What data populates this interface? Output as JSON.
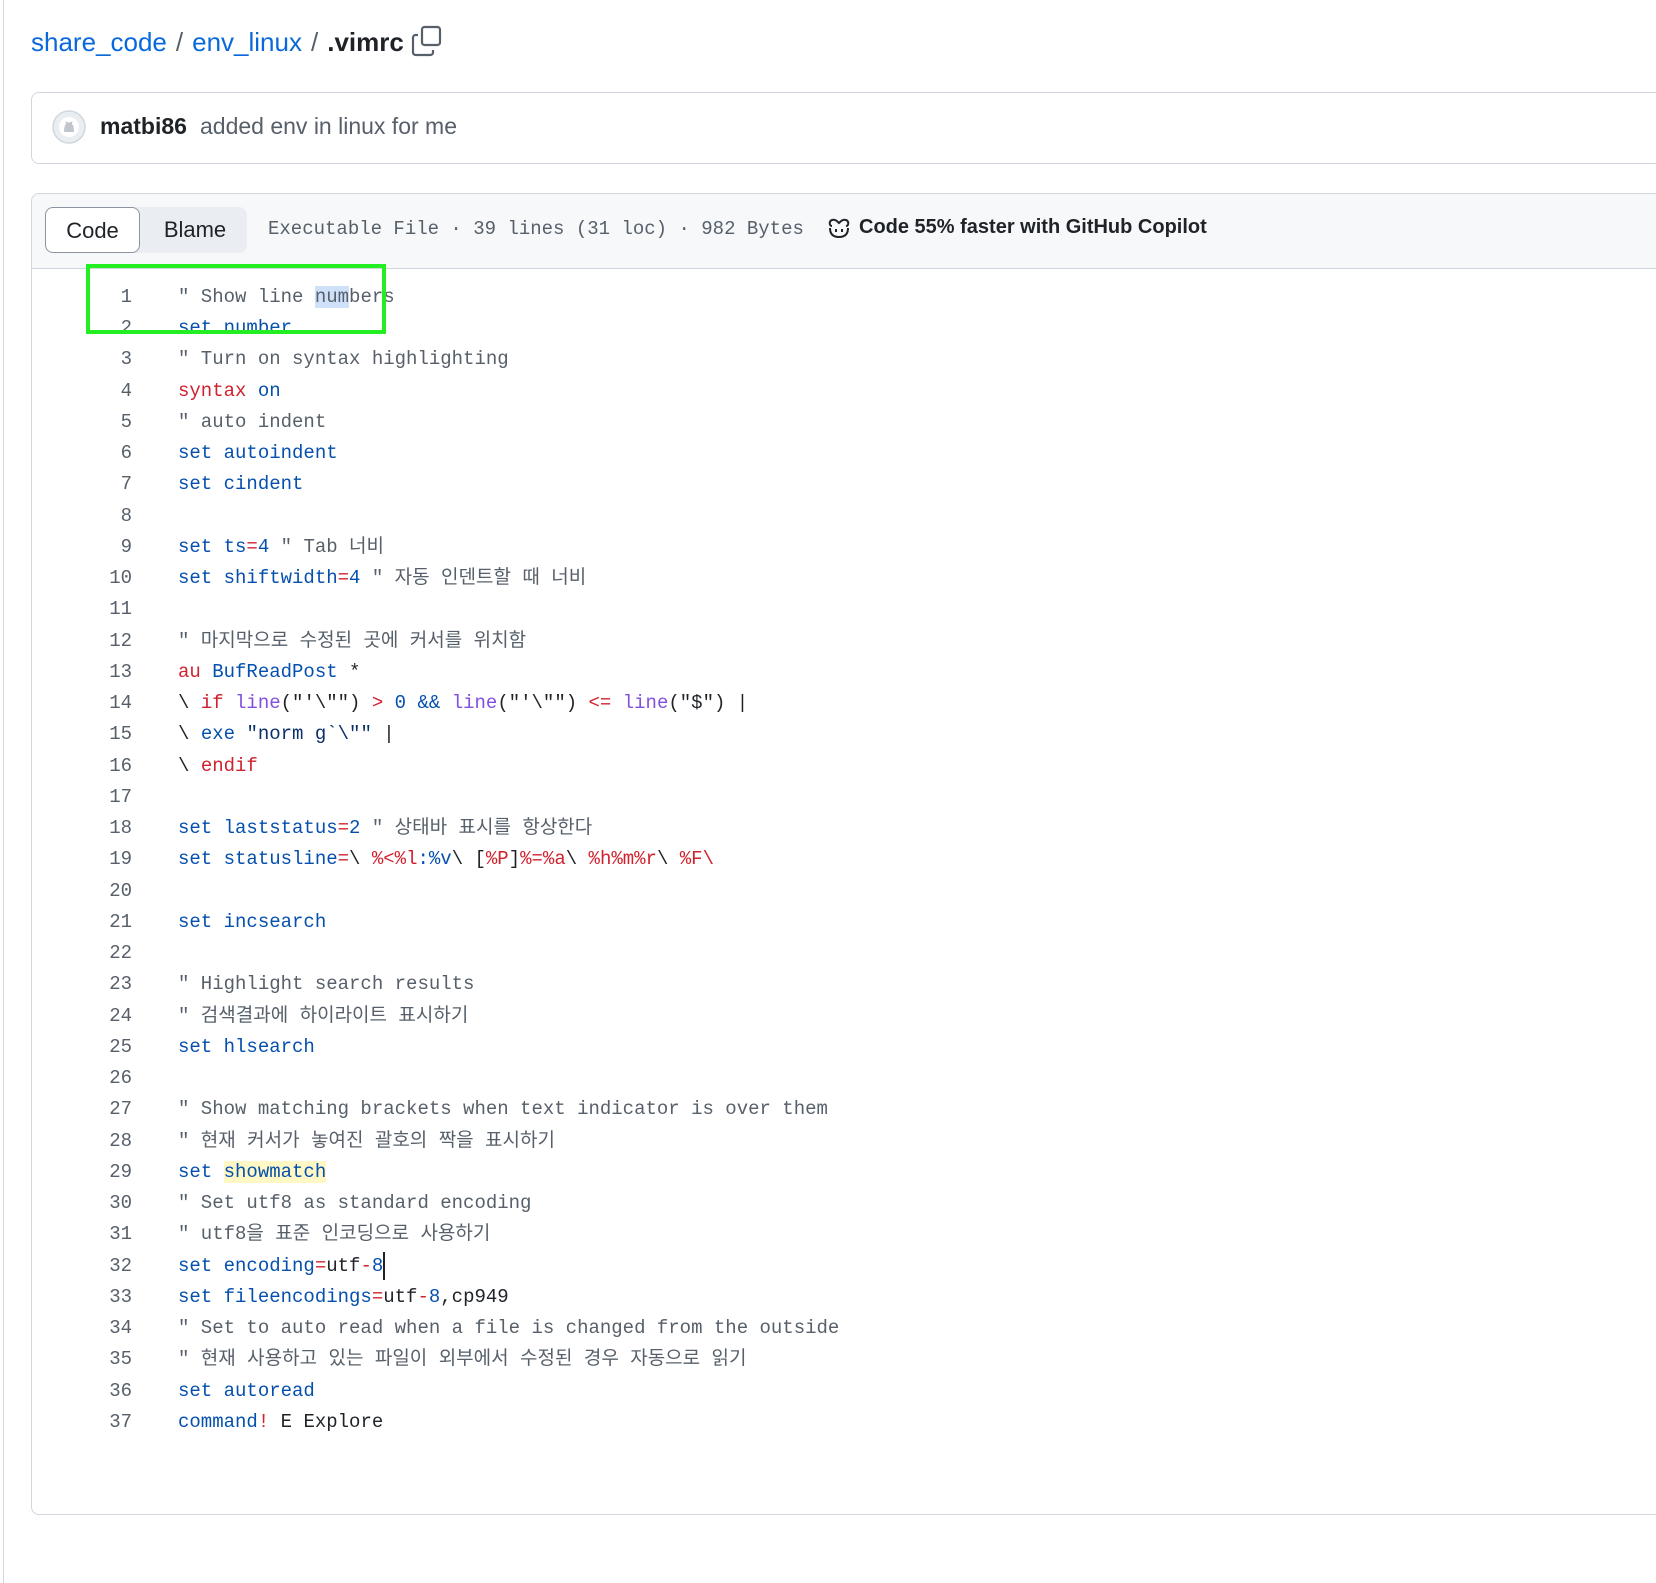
{
  "breadcrumb": {
    "repo": "share_code",
    "folder": "env_linux",
    "file": ".vimrc",
    "separator": "/"
  },
  "commit": {
    "author": "matbi86",
    "message": "added env in linux for me"
  },
  "file_header": {
    "tab_code": "Code",
    "tab_blame": "Blame",
    "meta": "Executable File · 39 lines (31 loc) · 982 Bytes",
    "copilot": "Code 55% faster with GitHub Copilot"
  },
  "code": {
    "line_numbers": [
      "1",
      "2",
      "3",
      "4",
      "5",
      "6",
      "7",
      "8",
      "9",
      "10",
      "11",
      "12",
      "13",
      "14",
      "15",
      "16",
      "17",
      "18",
      "19",
      "20",
      "21",
      "22",
      "23",
      "24",
      "25",
      "26",
      "27",
      "28",
      "29",
      "30",
      "31",
      "32",
      "33",
      "34",
      "35",
      "36",
      "37"
    ],
    "lines": [
      "\" Show line numbers",
      "set number",
      "\" Turn on syntax highlighting",
      "syntax on",
      "\" auto indent",
      "set autoindent",
      "set cindent",
      "",
      "set ts=4 \" Tab 너비",
      "set shiftwidth=4 \" 자동 인덴트할 때 너비",
      "",
      "\" 마지막으로 수정된 곳에 커서를 위치함",
      "au BufReadPost *",
      "\\ if line(\"'\\\"\") > 0 && line(\"'\\\"\") <= line(\"$\") |",
      "\\ exe \"norm g`\\\"\" |",
      "\\ endif",
      "",
      "set laststatus=2 \" 상태바 표시를 항상한다",
      "set statusline=\\ %<%l:%v\\ [%P]%=%a\\ %h%m%r\\ %F\\",
      "",
      "set incsearch",
      "",
      "\" Highlight search results",
      "\" 검색결과에 하이라이트 표시하기",
      "set hlsearch",
      "",
      "\" Show matching brackets when text indicator is over them",
      "\" 현재 커서가 놓여진 괄호의 짝을 표시하기",
      "set showmatch",
      "\" Set utf8 as standard encoding",
      "\" utf8을 표준 인코딩으로 사용하기",
      "set encoding=utf-8",
      "set fileencodings=utf-8,cp949",
      "\" Set to auto read when a file is changed from the outside",
      "\" 현재 사용하고 있는 파일이 외부에서 수정된 경우 자동으로 읽기",
      "set autoread",
      "command! E Explore"
    ]
  },
  "colors": {
    "link": "#0969da",
    "keyword": "#0550ae",
    "red_keyword": "#cf222e",
    "function": "#8250df",
    "comment": "#57606a",
    "annotation_box": "#22ee22"
  }
}
